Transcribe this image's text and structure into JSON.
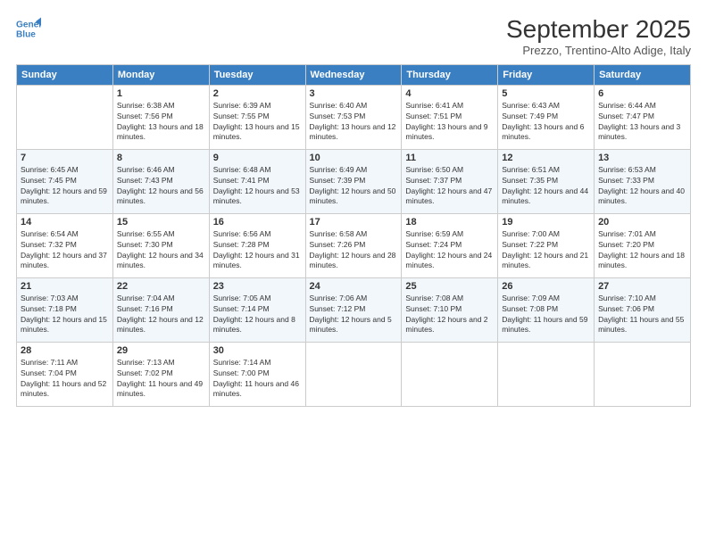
{
  "header": {
    "logo_line1": "General",
    "logo_line2": "Blue",
    "month": "September 2025",
    "location": "Prezzo, Trentino-Alto Adige, Italy"
  },
  "days_of_week": [
    "Sunday",
    "Monday",
    "Tuesday",
    "Wednesday",
    "Thursday",
    "Friday",
    "Saturday"
  ],
  "weeks": [
    [
      {
        "num": "",
        "sunrise": "",
        "sunset": "",
        "daylight": ""
      },
      {
        "num": "1",
        "sunrise": "Sunrise: 6:38 AM",
        "sunset": "Sunset: 7:56 PM",
        "daylight": "Daylight: 13 hours and 18 minutes."
      },
      {
        "num": "2",
        "sunrise": "Sunrise: 6:39 AM",
        "sunset": "Sunset: 7:55 PM",
        "daylight": "Daylight: 13 hours and 15 minutes."
      },
      {
        "num": "3",
        "sunrise": "Sunrise: 6:40 AM",
        "sunset": "Sunset: 7:53 PM",
        "daylight": "Daylight: 13 hours and 12 minutes."
      },
      {
        "num": "4",
        "sunrise": "Sunrise: 6:41 AM",
        "sunset": "Sunset: 7:51 PM",
        "daylight": "Daylight: 13 hours and 9 minutes."
      },
      {
        "num": "5",
        "sunrise": "Sunrise: 6:43 AM",
        "sunset": "Sunset: 7:49 PM",
        "daylight": "Daylight: 13 hours and 6 minutes."
      },
      {
        "num": "6",
        "sunrise": "Sunrise: 6:44 AM",
        "sunset": "Sunset: 7:47 PM",
        "daylight": "Daylight: 13 hours and 3 minutes."
      }
    ],
    [
      {
        "num": "7",
        "sunrise": "Sunrise: 6:45 AM",
        "sunset": "Sunset: 7:45 PM",
        "daylight": "Daylight: 12 hours and 59 minutes."
      },
      {
        "num": "8",
        "sunrise": "Sunrise: 6:46 AM",
        "sunset": "Sunset: 7:43 PM",
        "daylight": "Daylight: 12 hours and 56 minutes."
      },
      {
        "num": "9",
        "sunrise": "Sunrise: 6:48 AM",
        "sunset": "Sunset: 7:41 PM",
        "daylight": "Daylight: 12 hours and 53 minutes."
      },
      {
        "num": "10",
        "sunrise": "Sunrise: 6:49 AM",
        "sunset": "Sunset: 7:39 PM",
        "daylight": "Daylight: 12 hours and 50 minutes."
      },
      {
        "num": "11",
        "sunrise": "Sunrise: 6:50 AM",
        "sunset": "Sunset: 7:37 PM",
        "daylight": "Daylight: 12 hours and 47 minutes."
      },
      {
        "num": "12",
        "sunrise": "Sunrise: 6:51 AM",
        "sunset": "Sunset: 7:35 PM",
        "daylight": "Daylight: 12 hours and 44 minutes."
      },
      {
        "num": "13",
        "sunrise": "Sunrise: 6:53 AM",
        "sunset": "Sunset: 7:33 PM",
        "daylight": "Daylight: 12 hours and 40 minutes."
      }
    ],
    [
      {
        "num": "14",
        "sunrise": "Sunrise: 6:54 AM",
        "sunset": "Sunset: 7:32 PM",
        "daylight": "Daylight: 12 hours and 37 minutes."
      },
      {
        "num": "15",
        "sunrise": "Sunrise: 6:55 AM",
        "sunset": "Sunset: 7:30 PM",
        "daylight": "Daylight: 12 hours and 34 minutes."
      },
      {
        "num": "16",
        "sunrise": "Sunrise: 6:56 AM",
        "sunset": "Sunset: 7:28 PM",
        "daylight": "Daylight: 12 hours and 31 minutes."
      },
      {
        "num": "17",
        "sunrise": "Sunrise: 6:58 AM",
        "sunset": "Sunset: 7:26 PM",
        "daylight": "Daylight: 12 hours and 28 minutes."
      },
      {
        "num": "18",
        "sunrise": "Sunrise: 6:59 AM",
        "sunset": "Sunset: 7:24 PM",
        "daylight": "Daylight: 12 hours and 24 minutes."
      },
      {
        "num": "19",
        "sunrise": "Sunrise: 7:00 AM",
        "sunset": "Sunset: 7:22 PM",
        "daylight": "Daylight: 12 hours and 21 minutes."
      },
      {
        "num": "20",
        "sunrise": "Sunrise: 7:01 AM",
        "sunset": "Sunset: 7:20 PM",
        "daylight": "Daylight: 12 hours and 18 minutes."
      }
    ],
    [
      {
        "num": "21",
        "sunrise": "Sunrise: 7:03 AM",
        "sunset": "Sunset: 7:18 PM",
        "daylight": "Daylight: 12 hours and 15 minutes."
      },
      {
        "num": "22",
        "sunrise": "Sunrise: 7:04 AM",
        "sunset": "Sunset: 7:16 PM",
        "daylight": "Daylight: 12 hours and 12 minutes."
      },
      {
        "num": "23",
        "sunrise": "Sunrise: 7:05 AM",
        "sunset": "Sunset: 7:14 PM",
        "daylight": "Daylight: 12 hours and 8 minutes."
      },
      {
        "num": "24",
        "sunrise": "Sunrise: 7:06 AM",
        "sunset": "Sunset: 7:12 PM",
        "daylight": "Daylight: 12 hours and 5 minutes."
      },
      {
        "num": "25",
        "sunrise": "Sunrise: 7:08 AM",
        "sunset": "Sunset: 7:10 PM",
        "daylight": "Daylight: 12 hours and 2 minutes."
      },
      {
        "num": "26",
        "sunrise": "Sunrise: 7:09 AM",
        "sunset": "Sunset: 7:08 PM",
        "daylight": "Daylight: 11 hours and 59 minutes."
      },
      {
        "num": "27",
        "sunrise": "Sunrise: 7:10 AM",
        "sunset": "Sunset: 7:06 PM",
        "daylight": "Daylight: 11 hours and 55 minutes."
      }
    ],
    [
      {
        "num": "28",
        "sunrise": "Sunrise: 7:11 AM",
        "sunset": "Sunset: 7:04 PM",
        "daylight": "Daylight: 11 hours and 52 minutes."
      },
      {
        "num": "29",
        "sunrise": "Sunrise: 7:13 AM",
        "sunset": "Sunset: 7:02 PM",
        "daylight": "Daylight: 11 hours and 49 minutes."
      },
      {
        "num": "30",
        "sunrise": "Sunrise: 7:14 AM",
        "sunset": "Sunset: 7:00 PM",
        "daylight": "Daylight: 11 hours and 46 minutes."
      },
      {
        "num": "",
        "sunrise": "",
        "sunset": "",
        "daylight": ""
      },
      {
        "num": "",
        "sunrise": "",
        "sunset": "",
        "daylight": ""
      },
      {
        "num": "",
        "sunrise": "",
        "sunset": "",
        "daylight": ""
      },
      {
        "num": "",
        "sunrise": "",
        "sunset": "",
        "daylight": ""
      }
    ]
  ]
}
